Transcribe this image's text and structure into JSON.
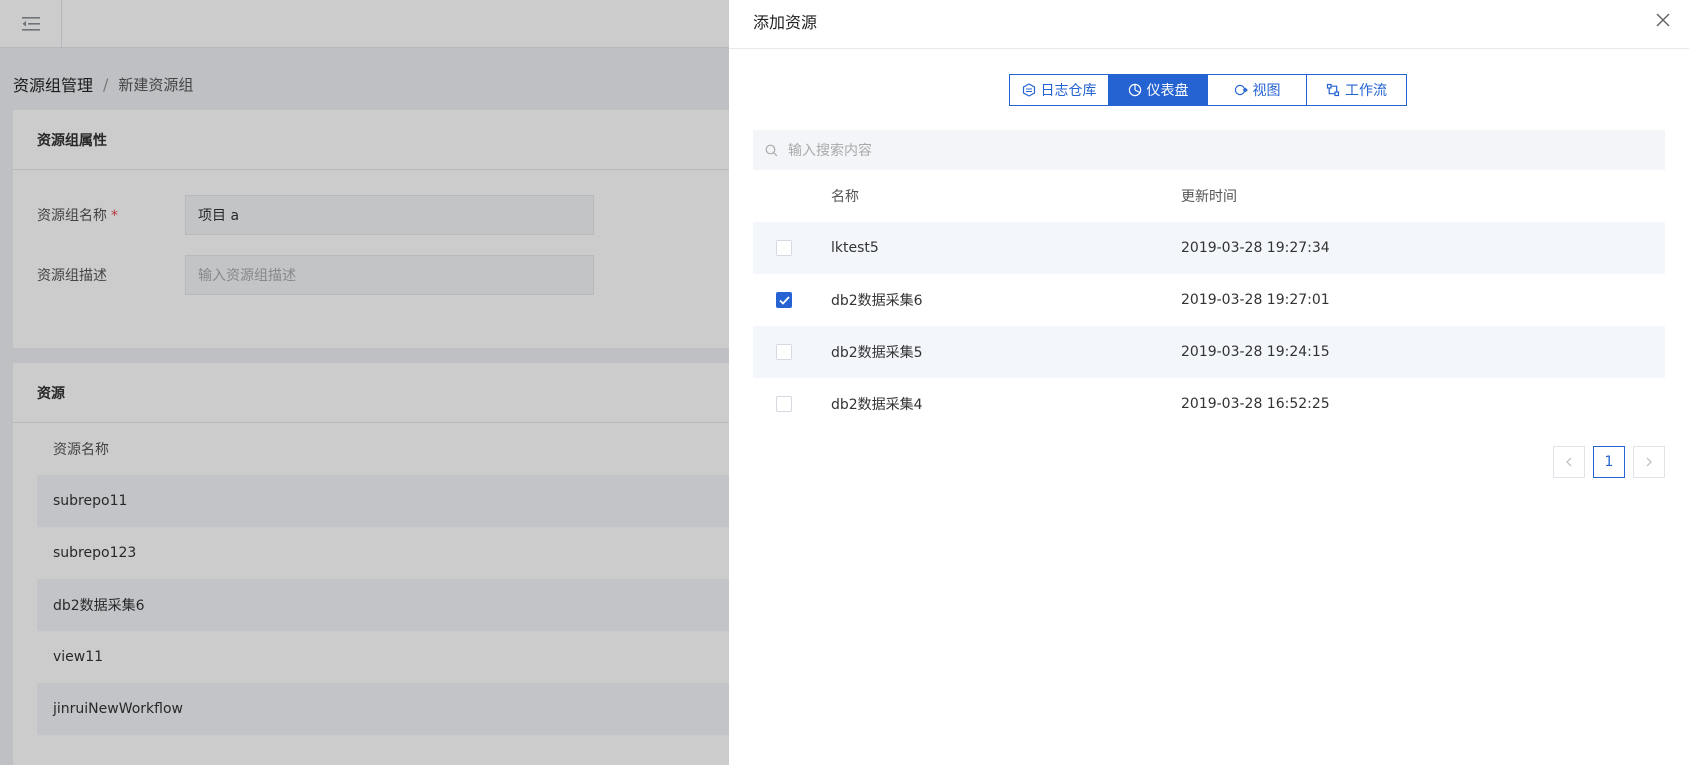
{
  "breadcrumb": {
    "parent": "资源组管理",
    "separator": "/",
    "current": "新建资源组"
  },
  "attributes_card": {
    "title": "资源组属性",
    "name_label": "资源组名称",
    "required_mark": "*",
    "name_value": "项目 a",
    "desc_label": "资源组描述",
    "desc_placeholder": "输入资源组描述"
  },
  "resources_card": {
    "title": "资源",
    "column_name": "资源名称",
    "rows": [
      {
        "name": "subrepo11"
      },
      {
        "name": "subrepo123"
      },
      {
        "name": "db2数据采集6"
      },
      {
        "name": "view11"
      },
      {
        "name": "jinruiNewWorkflow"
      }
    ]
  },
  "drawer": {
    "title": "添加资源",
    "tabs": [
      {
        "label": "日志仓库",
        "icon": "repository-icon",
        "active": false
      },
      {
        "label": "仪表盘",
        "icon": "dashboard-icon",
        "active": true
      },
      {
        "label": "视图",
        "icon": "view-icon",
        "active": false
      },
      {
        "label": "工作流",
        "icon": "workflow-icon",
        "active": false
      }
    ],
    "search_placeholder": "输入搜索内容",
    "table": {
      "col_name": "名称",
      "col_time": "更新时间",
      "rows": [
        {
          "name": "lktest5",
          "time": "2019-03-28 19:27:34",
          "checked": false
        },
        {
          "name": "db2数据采集6",
          "time": "2019-03-28 19:27:01",
          "checked": true
        },
        {
          "name": "db2数据采集5",
          "time": "2019-03-28 19:24:15",
          "checked": false
        },
        {
          "name": "db2数据采集4",
          "time": "2019-03-28 16:52:25",
          "checked": false
        }
      ]
    },
    "pagination": {
      "current_page": "1"
    }
  },
  "colors": {
    "accent": "#2463d1",
    "required": "#e5484d",
    "row_alt": "#f3f6fa"
  }
}
